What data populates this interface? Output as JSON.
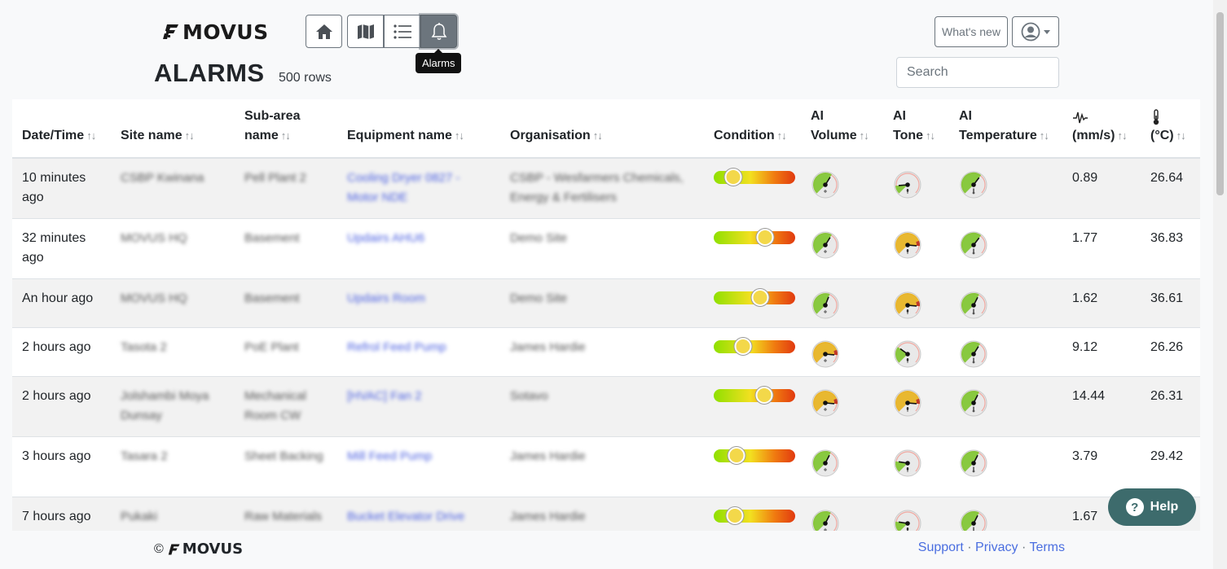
{
  "brand": {
    "name": "MOVUS"
  },
  "nav": {
    "buttons": [
      {
        "icon": "home-icon"
      },
      {
        "icon": "map-icon"
      },
      {
        "icon": "list-icon"
      },
      {
        "icon": "bell-icon",
        "active": true
      }
    ],
    "tooltip": "Alarms"
  },
  "page": {
    "title": "ALARMS",
    "row_count": "500 rows"
  },
  "header_right": {
    "whats_new": "What's new",
    "search_placeholder": "Search"
  },
  "table": {
    "columns": [
      {
        "label": "Date/Time",
        "sort": "↑↓"
      },
      {
        "label": "Site name",
        "sort": "↑↓"
      },
      {
        "label": "Sub-area name",
        "sort": "↑↓"
      },
      {
        "label": "Equipment name",
        "sort": "↑↓"
      },
      {
        "label": "Organisation",
        "sort": "↑↓"
      },
      {
        "label": "Condition",
        "sort": "↑↓"
      },
      {
        "label": "AI Volume",
        "sort": "↑↓"
      },
      {
        "label": "AI Tone",
        "sort": "↑↓"
      },
      {
        "label": "AI Temperature",
        "sort": "↑↓"
      },
      {
        "label": "(mm/s)",
        "sort": "↑↓",
        "icon": "vibration-icon"
      },
      {
        "label": "(°C)",
        "sort": "↑↓",
        "icon": "thermometer-icon"
      }
    ],
    "rows": [
      {
        "time": "10 minutes ago",
        "site": "CSBP Kwinana",
        "subarea": "Pell Plant 2",
        "equipment": "Cooling Dryer 0827 - Motor NDE",
        "org": "CSBP - Wesfarmers Chemicals, Energy & Fertilisers",
        "condition": 0.24,
        "vol": 0.62,
        "tone": 0.15,
        "temp": 0.64,
        "mms": "0.89",
        "degc": "26.64"
      },
      {
        "time": "32 minutes ago",
        "site": "MOVUS HQ",
        "subarea": "Basement",
        "equipment": "Updairs AHU6",
        "org": "Demo Site",
        "condition": 0.63,
        "vol": 0.62,
        "tone": 0.85,
        "temp": 0.64,
        "mms": "1.77",
        "degc": "36.83"
      },
      {
        "time": "An hour ago",
        "site": "MOVUS HQ",
        "subarea": "Basement",
        "equipment": "Updairs Room",
        "org": "Demo Site",
        "condition": 0.57,
        "vol": 0.58,
        "tone": 0.85,
        "temp": 0.6,
        "mms": "1.62",
        "degc": "36.61"
      },
      {
        "time": "2 hours ago",
        "site": "Tasota 2",
        "subarea": "PoE Plant",
        "equipment": "Refrol Feed Pump",
        "org": "James Hardie",
        "condition": 0.36,
        "vol": 0.85,
        "tone": 0.3,
        "temp": 0.62,
        "mms": "9.12",
        "degc": "26.26"
      },
      {
        "time": "2 hours ago",
        "site": "Jolshambi Moya Dunsay",
        "subarea": "Mechanical Room CW",
        "equipment": "[HVAC] Fan 2",
        "org": "Sotavo",
        "condition": 0.62,
        "vol": 0.85,
        "tone": 0.85,
        "temp": 0.6,
        "mms": "14.44",
        "degc": "26.31"
      },
      {
        "time": "3 hours ago",
        "site": "Tasara 2",
        "subarea": "Sheet Backing",
        "equipment": "Mill Feed Pump",
        "org": "James Hardie",
        "condition": 0.28,
        "vol": 0.6,
        "tone": 0.2,
        "temp": 0.6,
        "mms": "3.79",
        "degc": "29.42"
      },
      {
        "time": "7 hours ago",
        "site": "Pukaki",
        "subarea": "Raw Materials",
        "equipment": "Bucket Elevator Drive",
        "org": "James Hardie",
        "condition": 0.26,
        "vol": 0.6,
        "tone": 0.2,
        "temp": 0.6,
        "mms": "1.67",
        "degc": ""
      }
    ]
  },
  "footer": {
    "copyright": "©",
    "brand": "MOVUS",
    "links": [
      "Support",
      "Privacy",
      "Terms"
    ],
    "separator": "·"
  },
  "help": {
    "label": "Help"
  },
  "colors": {
    "accent": "#6c757d",
    "help_bg": "#3d6b6c",
    "link": "#4a6ee0"
  }
}
